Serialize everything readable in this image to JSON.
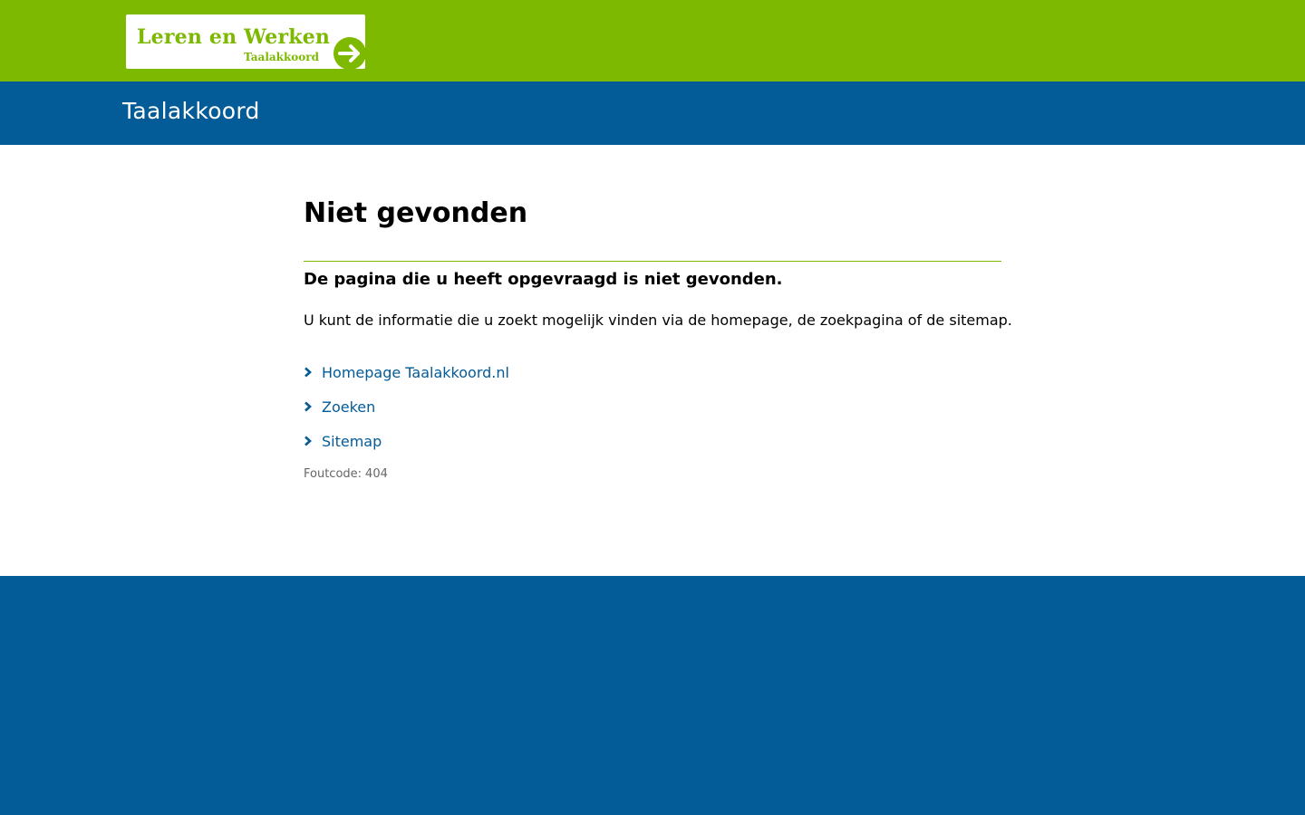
{
  "header": {
    "logo_title": "Leren en Werken",
    "logo_subtitle": "Taalakkoord",
    "site_title": "Taalakkoord"
  },
  "main": {
    "title": "Niet gevonden",
    "subtitle": "De pagina die u heeft opgevraagd is niet gevonden.",
    "paragraph": "U kunt de informatie die u zoekt mogelijk vinden via de homepage, de zoekpagina of de sitemap.",
    "links": [
      {
        "label": "Homepage Taalakkoord.nl"
      },
      {
        "label": "Zoeken"
      },
      {
        "label": "Sitemap"
      }
    ],
    "error_label": "Foutcode:",
    "error_code": "404"
  },
  "colors": {
    "brand_green": "#7cb900",
    "brand_blue": "#035b98",
    "link": "#035b98"
  },
  "icons": {
    "logo_arrow": "arrow-right-icon",
    "link_bullet": "chevron-right-icon"
  }
}
